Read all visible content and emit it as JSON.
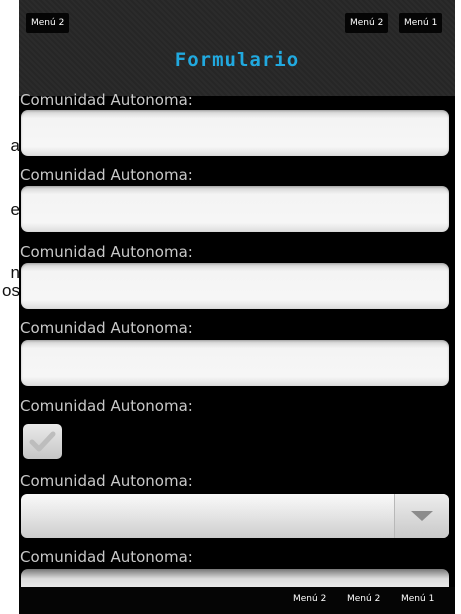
{
  "left_edge_fragments": [
    "a",
    "e",
    "n",
    "os"
  ],
  "top_menu": {
    "left": "Menú 2",
    "right_1": "Menú 2",
    "right_2": "Menú 1"
  },
  "title": "Formulario",
  "form": {
    "labels": [
      "Comunidad Autonoma:",
      "Comunidad Autonoma:",
      "Comunidad Autonoma:",
      "Comunidad Autonoma:",
      "Comunidad Autonoma:",
      "Comunidad Autonoma:",
      "Comunidad Autonoma:"
    ],
    "checkbox_checked": true
  },
  "icons": {
    "checkbox": "checkmark-icon",
    "select": "chevron-down-icon"
  },
  "colors": {
    "title": "#21a9df",
    "background": "#000000",
    "label": "#c8c8c8"
  },
  "bottom_menu": {
    "item_1": "Menú 2",
    "item_2": "Menú 2",
    "item_3": "Menú 1"
  }
}
